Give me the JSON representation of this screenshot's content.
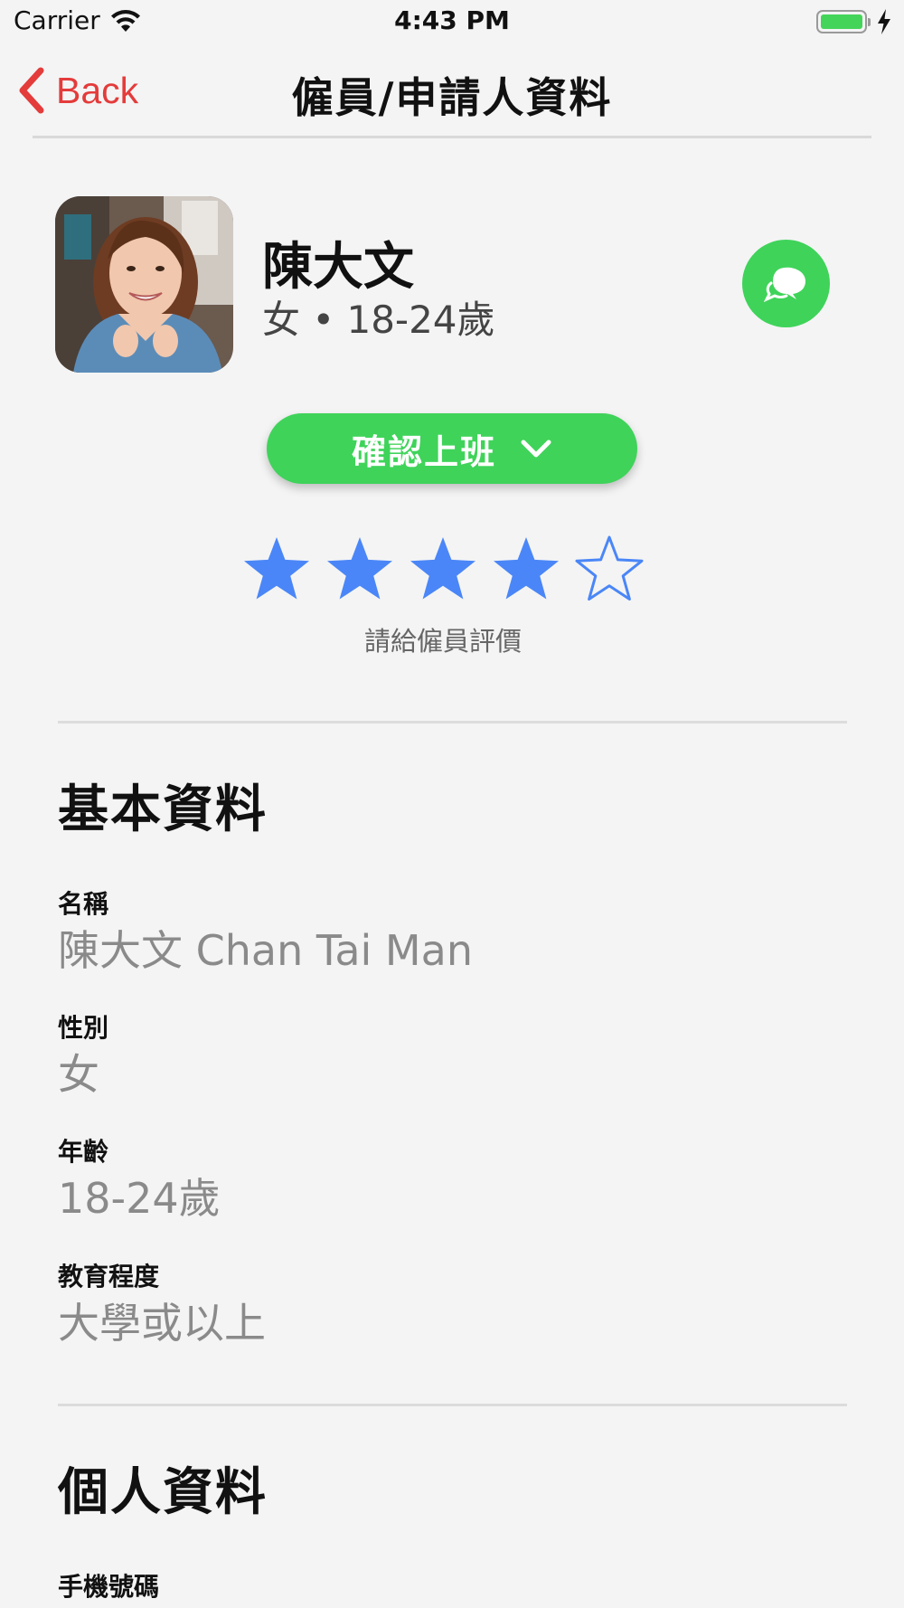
{
  "status_bar": {
    "carrier": "Carrier",
    "time": "4:43 PM",
    "battery_level": 1.0
  },
  "nav": {
    "back_label": "Back",
    "title": "僱員/申請人資料"
  },
  "profile": {
    "name": "陳大文",
    "subtitle": "女 • 18-24歲",
    "confirm_button_label": "確認上班",
    "rating": {
      "value": 4,
      "max": 5,
      "label": "請給僱員評價"
    }
  },
  "basic_info": {
    "title": "基本資料",
    "fields": [
      {
        "label": "名稱",
        "value": "陳大文 Chan Tai Man"
      },
      {
        "label": "性別",
        "value": "女"
      },
      {
        "label": "年齡",
        "value": "18-24歲"
      },
      {
        "label": "教育程度",
        "value": "大學或以上"
      }
    ]
  },
  "personal_info": {
    "title": "個人資料",
    "fields": [
      {
        "label": "手機號碼"
      }
    ]
  },
  "icons": {
    "back": "chevron-left-icon",
    "chat": "chat-bubbles-icon",
    "dropdown": "chevron-down-icon",
    "star_filled": "star-filled-icon",
    "star_empty": "star-outline-icon"
  },
  "colors": {
    "accent_green": "#3fd35a",
    "back_red": "#e43b3b",
    "star_blue": "#4a86f7",
    "background": "#f4f4f4"
  }
}
